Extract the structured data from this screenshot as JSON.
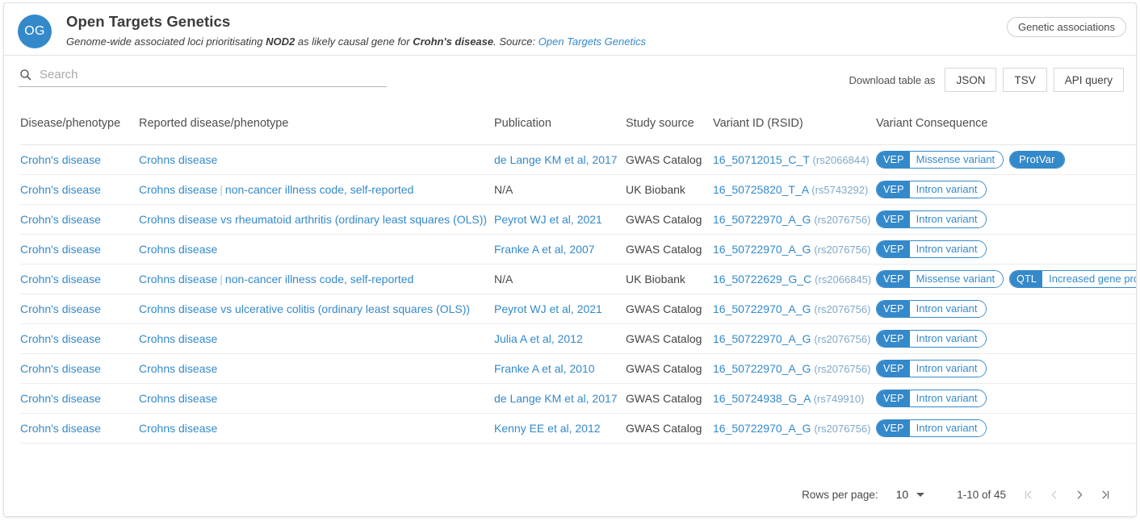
{
  "header": {
    "logo_initials": "OG",
    "title": "Open Targets Genetics",
    "subtitle_part1": "Genome-wide associated loci prioritisating ",
    "subtitle_gene": "NOD2",
    "subtitle_part2": " as likely causal gene for ",
    "subtitle_disease": "Crohn's disease",
    "subtitle_part3": ". Source: ",
    "source_link": "Open Targets Genetics",
    "badge": "Genetic associations"
  },
  "toolbar": {
    "search_placeholder": "Search",
    "search_value": "",
    "download_label": "Download table as",
    "buttons": [
      "JSON",
      "TSV",
      "API query"
    ]
  },
  "table": {
    "columns": [
      "Disease/phenotype",
      "Reported disease/phenotype",
      "Publication",
      "Study source",
      "Variant ID (RSID)",
      "Variant Consequence"
    ],
    "rows": [
      {
        "disease": "Crohn's disease",
        "reported": "Crohns disease",
        "reported_extra": "",
        "publication": "de Lange KM et al, 2017",
        "publication_link": true,
        "study_source": "GWAS Catalog",
        "variant_id": "16_50712015_C_T",
        "rsid": "(rs2066844)",
        "consequences": [
          {
            "key": "VEP",
            "value": "Missense variant",
            "style": "split"
          },
          {
            "key": "ProtVar",
            "value": "",
            "style": "solid"
          }
        ]
      },
      {
        "disease": "Crohn's disease",
        "reported": "Crohns disease",
        "reported_extra": "non-cancer illness code, self-reported",
        "publication": "N/A",
        "publication_link": false,
        "study_source": "UK Biobank",
        "variant_id": "16_50725820_T_A",
        "rsid": "(rs5743292)",
        "consequences": [
          {
            "key": "VEP",
            "value": "Intron variant",
            "style": "split"
          }
        ]
      },
      {
        "disease": "Crohn's disease",
        "reported": "Crohns disease vs rheumatoid arthritis (ordinary least squares (OLS))",
        "reported_extra": "",
        "publication": "Peyrot WJ et al, 2021",
        "publication_link": true,
        "study_source": "GWAS Catalog",
        "variant_id": "16_50722970_A_G",
        "rsid": "(rs2076756)",
        "consequences": [
          {
            "key": "VEP",
            "value": "Intron variant",
            "style": "split"
          }
        ]
      },
      {
        "disease": "Crohn's disease",
        "reported": "Crohns disease",
        "reported_extra": "",
        "publication": "Franke A et al, 2007",
        "publication_link": true,
        "study_source": "GWAS Catalog",
        "variant_id": "16_50722970_A_G",
        "rsid": "(rs2076756)",
        "consequences": [
          {
            "key": "VEP",
            "value": "Intron variant",
            "style": "split"
          }
        ]
      },
      {
        "disease": "Crohn's disease",
        "reported": "Crohns disease",
        "reported_extra": "non-cancer illness code, self-reported",
        "publication": "N/A",
        "publication_link": false,
        "study_source": "UK Biobank",
        "variant_id": "16_50722629_G_C",
        "rsid": "(rs2066845)",
        "consequences": [
          {
            "key": "VEP",
            "value": "Missense variant",
            "style": "split"
          },
          {
            "key": "QTL",
            "value": "Increased gene product level",
            "style": "split"
          }
        ]
      },
      {
        "disease": "Crohn's disease",
        "reported": "Crohns disease vs ulcerative colitis (ordinary least squares (OLS))",
        "reported_extra": "",
        "publication": "Peyrot WJ et al, 2021",
        "publication_link": true,
        "study_source": "GWAS Catalog",
        "variant_id": "16_50722970_A_G",
        "rsid": "(rs2076756)",
        "consequences": [
          {
            "key": "VEP",
            "value": "Intron variant",
            "style": "split"
          }
        ]
      },
      {
        "disease": "Crohn's disease",
        "reported": "Crohns disease",
        "reported_extra": "",
        "publication": "Julia A et al, 2012",
        "publication_link": true,
        "study_source": "GWAS Catalog",
        "variant_id": "16_50722970_A_G",
        "rsid": "(rs2076756)",
        "consequences": [
          {
            "key": "VEP",
            "value": "Intron variant",
            "style": "split"
          }
        ]
      },
      {
        "disease": "Crohn's disease",
        "reported": "Crohns disease",
        "reported_extra": "",
        "publication": "Franke A et al, 2010",
        "publication_link": true,
        "study_source": "GWAS Catalog",
        "variant_id": "16_50722970_A_G",
        "rsid": "(rs2076756)",
        "consequences": [
          {
            "key": "VEP",
            "value": "Intron variant",
            "style": "split"
          }
        ]
      },
      {
        "disease": "Crohn's disease",
        "reported": "Crohns disease",
        "reported_extra": "",
        "publication": "de Lange KM et al, 2017",
        "publication_link": true,
        "study_source": "GWAS Catalog",
        "variant_id": "16_50724938_G_A",
        "rsid": "(rs749910)",
        "consequences": [
          {
            "key": "VEP",
            "value": "Intron variant",
            "style": "split"
          }
        ]
      },
      {
        "disease": "Crohn's disease",
        "reported": "Crohns disease",
        "reported_extra": "",
        "publication": "Kenny EE et al, 2012",
        "publication_link": true,
        "study_source": "GWAS Catalog",
        "variant_id": "16_50722970_A_G",
        "rsid": "(rs2076756)",
        "consequences": [
          {
            "key": "VEP",
            "value": "Intron variant",
            "style": "split"
          }
        ]
      }
    ]
  },
  "footer": {
    "rows_per_page_label": "Rows per page:",
    "rows_per_page_value": "10",
    "range_label": "1-10 of 45",
    "first_icon": "|<",
    "prev_icon": "‹",
    "next_icon": "›",
    "last_icon": ">|"
  },
  "colors": {
    "accent": "#3489ca",
    "text": "#444444",
    "muted": "#a8a8a8",
    "border": "#e0e0e0"
  }
}
